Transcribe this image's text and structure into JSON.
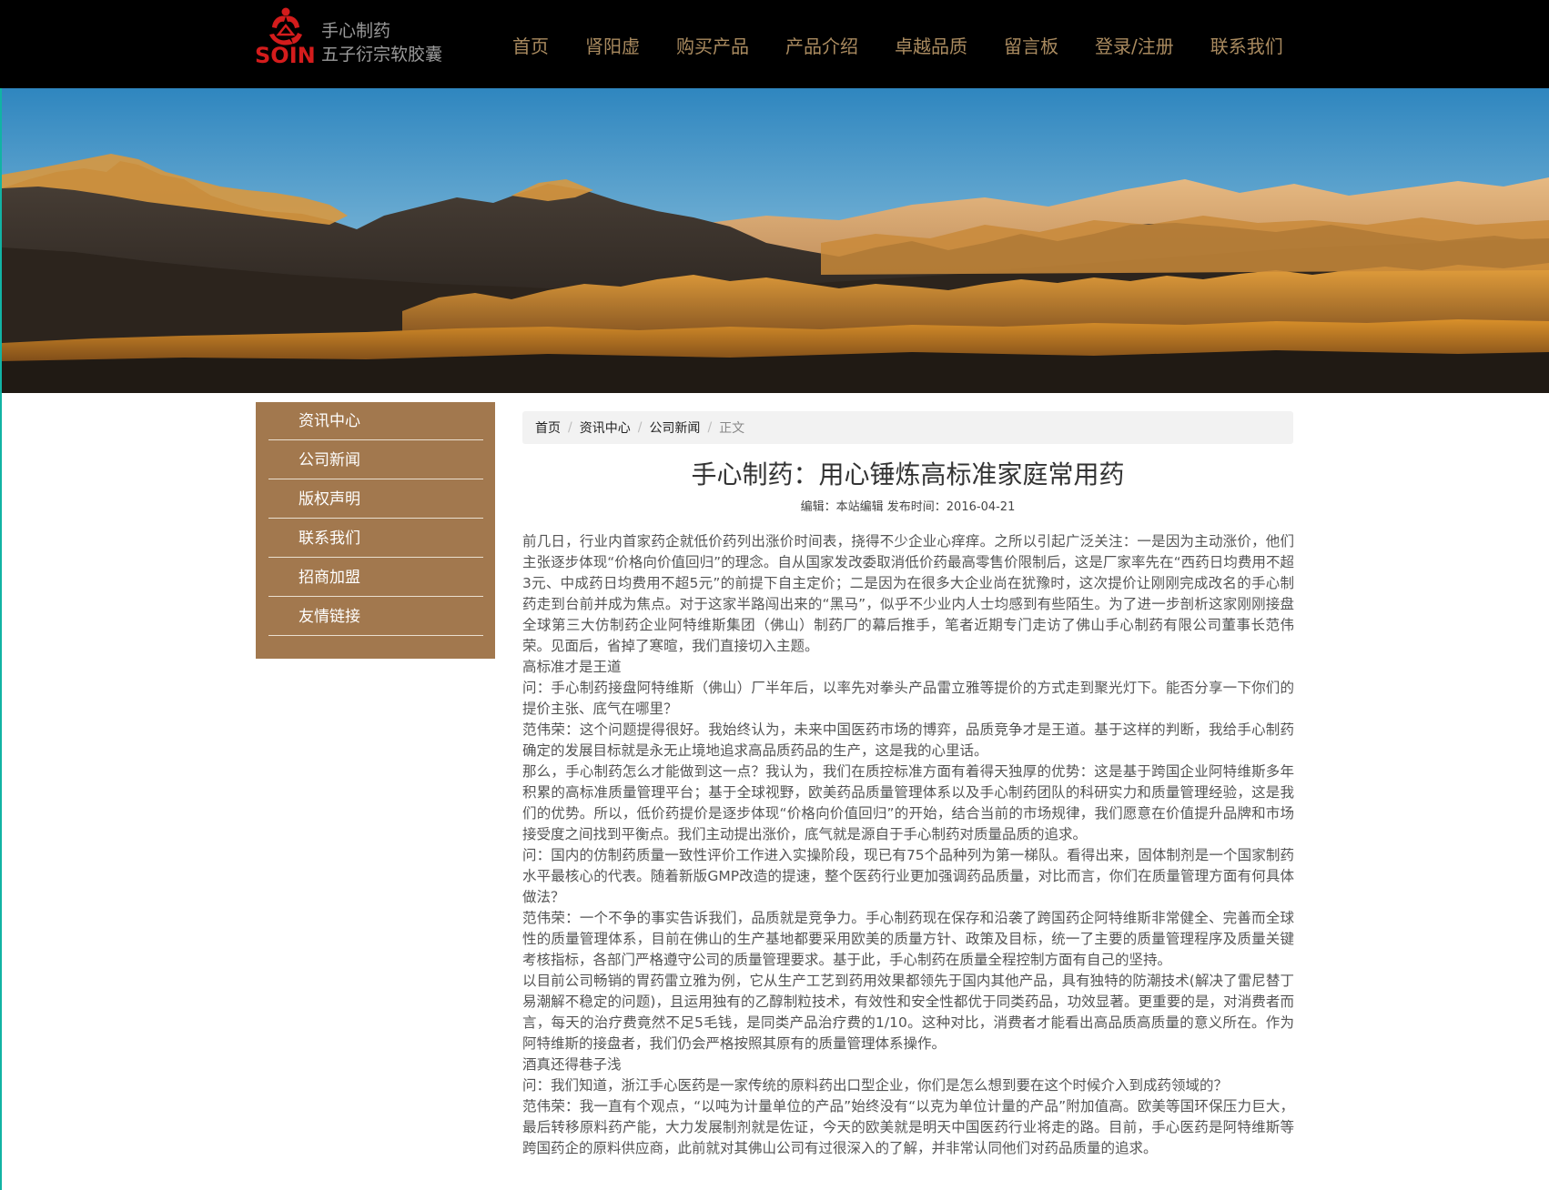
{
  "header": {
    "logo_text": "SOIN",
    "company": "手心制药",
    "product": "五子衍宗软胶囊",
    "nav": [
      "首页",
      "肾阳虚",
      "购买产品",
      "产品介绍",
      "卓越品质",
      "留言板",
      "登录/注册",
      "联系我们"
    ]
  },
  "colors": {
    "header_bg": "#000000",
    "nav_text": "#a98a5f",
    "sidebar_bg": "#a2784e",
    "logo_red": "#d41c1c"
  },
  "sidebar": {
    "items": [
      "资讯中心",
      "公司新闻",
      "版权声明",
      "联系我们",
      "招商加盟",
      "友情链接"
    ]
  },
  "breadcrumb": [
    "首页",
    "资讯中心",
    "公司新闻",
    "正文"
  ],
  "article": {
    "title": "手心制药：用心锤炼高标准家庭常用药",
    "meta": "编辑：本站编辑 发布时间：2016-04-21",
    "paragraphs": [
      "前几日，行业内首家药企就低价药列出涨价时间表，挠得不少企业心痒痒。之所以引起广泛关注：一是因为主动涨价，他们主张逐步体现“价格向价值回归”的理念。自从国家发改委取消低价药最高零售价限制后，这是厂家率先在“西药日均费用不超3元、中成药日均费用不超5元”的前提下自主定价；二是因为在很多大企业尚在犹豫时，这次提价让刚刚完成改名的手心制药走到台前并成为焦点。对于这家半路闯出来的“黑马”，似乎不少业内人士均感到有些陌生。为了进一步剖析这家刚刚接盘全球第三大仿制药企业阿特维斯集团（佛山）制药厂的幕后推手，笔者近期专门走访了佛山手心制药有限公司董事长范伟荣。见面后，省掉了寒暄，我们直接切入主题。",
      "高标准才是王道",
      "问：手心制药接盘阿特维斯（佛山）厂半年后，以率先对拳头产品雷立雅等提价的方式走到聚光灯下。能否分享一下你们的提价主张、底气在哪里？",
      "范伟荣：这个问题提得很好。我始终认为，未来中国医药市场的博弈，品质竞争才是王道。基于这样的判断，我给手心制药确定的发展目标就是永无止境地追求高品质药品的生产，这是我的心里话。",
      "那么，手心制药怎么才能做到这一点？我认为，我们在质控标准方面有着得天独厚的优势：这是基于跨国企业阿特维斯多年积累的高标准质量管理平台；基于全球视野，欧美药品质量管理体系以及手心制药团队的科研实力和质量管理经验，这是我们的优势。所以，低价药提价是逐步体现“价格向价值回归”的开始，结合当前的市场规律，我们愿意在价值提升品牌和市场接受度之间找到平衡点。我们主动提出涨价，底气就是源自于手心制药对质量品质的追求。",
      "问：国内的仿制药质量一致性评价工作进入实操阶段，现已有75个品种列为第一梯队。看得出来，固体制剂是一个国家制药水平最核心的代表。随着新版GMP改造的提速，整个医药行业更加强调药品质量，对比而言，你们在质量管理方面有何具体做法？",
      "范伟荣：一个不争的事实告诉我们，品质就是竞争力。手心制药现在保存和沿袭了跨国药企阿特维斯非常健全、完善而全球性的质量管理体系，目前在佛山的生产基地都要采用欧美的质量方针、政策及目标，统一了主要的质量管理程序及质量关键考核指标，各部门严格遵守公司的质量管理要求。基于此，手心制药在质量全程控制方面有自己的坚持。",
      "以目前公司畅销的胃药雷立雅为例，它从生产工艺到药用效果都领先于国内其他产品，具有独特的防潮技术(解决了雷尼替丁易潮解不稳定的问题)，且运用独有的乙醇制粒技术，有效性和安全性都优于同类药品，功效显著。更重要的是，对消费者而言，每天的治疗费竟然不足5毛钱，是同类产品治疗费的1/10。这种对比，消费者才能看出高品质高质量的意义所在。作为阿特维斯的接盘者，我们仍会严格按照其原有的质量管理体系操作。",
      "酒真还得巷子浅",
      "问：我们知道，浙江手心医药是一家传统的原料药出口型企业，你们是怎么想到要在这个时候介入到成药领域的？",
      "范伟荣：我一直有个观点，“以吨为计量单位的产品”始终没有“以克为单位计量的产品”附加值高。欧美等国环保压力巨大，最后转移原料药产能，大力发展制剂就是佐证，今天的欧美就是明天中国医药行业将走的路。目前，手心医药是阿特维斯等跨国药企的原料供应商，此前就对其佛山公司有过很深入的了解，并非常认同他们对药品质量的追求。"
    ]
  }
}
